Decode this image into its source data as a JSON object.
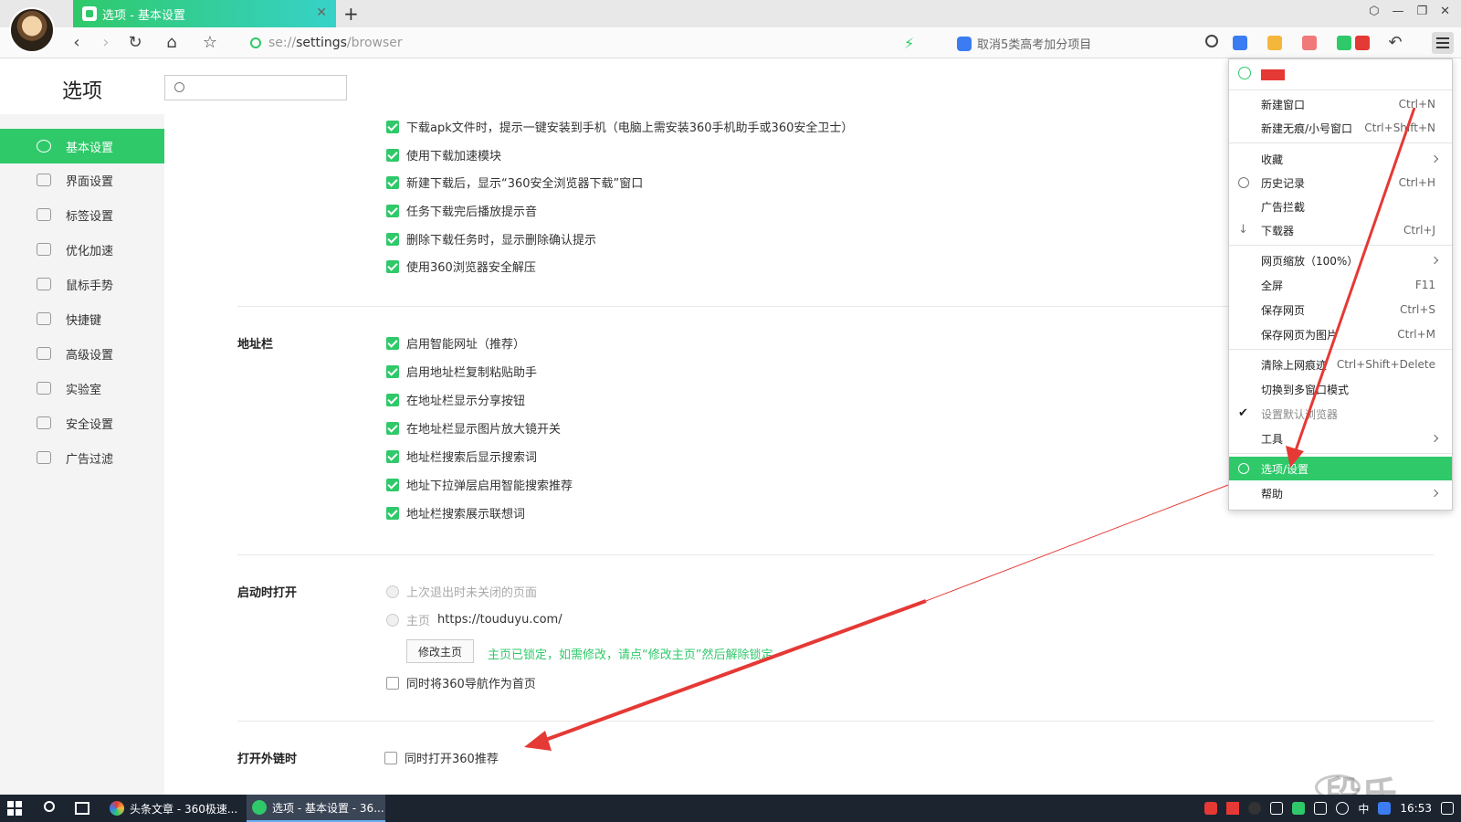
{
  "browser": {
    "active_tab_title": "选项 - 基本设置",
    "new_tab_label": "+",
    "address_scheme": "se://",
    "address_host": "settings",
    "address_path": "/browser",
    "search_hint": "取消5类高考加分项目",
    "window_controls": [
      "⬡",
      "—",
      "❐",
      "✕"
    ]
  },
  "settings": {
    "page_title": "选项",
    "search_placeholder": "",
    "sidebar": [
      {
        "label": "基本设置",
        "icon": "settings-icon",
        "active": true
      },
      {
        "label": "界面设置",
        "icon": "layout-icon",
        "active": false
      },
      {
        "label": "标签设置",
        "icon": "tab-icon",
        "active": false
      },
      {
        "label": "优化加速",
        "icon": "bolt-icon",
        "active": false
      },
      {
        "label": "鼠标手势",
        "icon": "mouse-icon",
        "active": false
      },
      {
        "label": "快捷键",
        "icon": "keyboard-icon",
        "active": false
      },
      {
        "label": "高级设置",
        "icon": "wrench-icon",
        "active": false
      },
      {
        "label": "实验室",
        "icon": "flask-icon",
        "active": false
      },
      {
        "label": "安全设置",
        "icon": "shield-icon",
        "active": false
      },
      {
        "label": "广告过滤",
        "icon": "block-icon",
        "active": false
      }
    ],
    "download_options": [
      {
        "label": "下载apk文件时，提示一键安装到手机（电脑上需安装360手机助手或360安全卫士）",
        "checked": true
      },
      {
        "label": "使用下载加速模块",
        "checked": true
      },
      {
        "label": "新建下载后，显示“360安全浏览器下载”窗口",
        "checked": true
      },
      {
        "label": "任务下载完后播放提示音",
        "checked": true
      },
      {
        "label": "删除下载任务时，显示删除确认提示",
        "checked": true
      },
      {
        "label": "使用360浏览器安全解压",
        "checked": true
      }
    ],
    "address_bar": {
      "label": "地址栏",
      "options": [
        {
          "label": "启用智能网址（推荐）",
          "checked": true
        },
        {
          "label": "启用地址栏复制粘贴助手",
          "checked": true
        },
        {
          "label": "在地址栏显示分享按钮",
          "checked": true
        },
        {
          "label": "在地址栏显示图片放大镜开关",
          "checked": true
        },
        {
          "label": "地址栏搜索后显示搜索词",
          "checked": true
        },
        {
          "label": "地址下拉弹层启用智能搜索推荐",
          "checked": true
        },
        {
          "label": "地址栏搜索展示联想词",
          "checked": true
        }
      ]
    },
    "startup": {
      "label": "启动时打开",
      "option_last_session": "上次退出时未关闭的页面",
      "option_homepage": "主页",
      "homepage_url": "https://touduyu.com/",
      "edit_home_button": "修改主页",
      "lock_note": "主页已锁定，如需修改，请点“修改主页”然后解除锁定",
      "nav_as_home": {
        "label": "同时将360导航作为首页",
        "checked": false
      }
    },
    "external_links": {
      "label": "打开外链时",
      "option": {
        "label": "同时打开360推荐",
        "checked": false
      }
    }
  },
  "menu": {
    "items": [
      {
        "label": "新建窗口",
        "shortcut": "Ctrl+N"
      },
      {
        "label": "新建无痕/小号窗口",
        "shortcut": "Ctrl+Shift+N"
      },
      {
        "label": "收藏",
        "submenu": true
      },
      {
        "label": "历史记录",
        "shortcut": "Ctrl+H",
        "icon": "clock-icon"
      },
      {
        "label": "广告拦截"
      },
      {
        "label": "下载器",
        "shortcut": "Ctrl+J",
        "icon": "download-icon"
      },
      {
        "label": "网页缩放（100%）",
        "submenu": true
      },
      {
        "label": "全屏",
        "shortcut": "F11"
      },
      {
        "label": "保存网页",
        "shortcut": "Ctrl+S"
      },
      {
        "label": "保存网页为图片",
        "shortcut": "Ctrl+M"
      },
      {
        "label": "清除上网痕迹",
        "shortcut": "Ctrl+Shift+Delete"
      },
      {
        "label": "切换到多窗口模式"
      },
      {
        "label": "设置默认浏览器",
        "checked": true
      },
      {
        "label": "工具",
        "submenu": true
      },
      {
        "label": "选项/设置",
        "highlight": true,
        "icon": "gear-icon"
      },
      {
        "label": "帮助",
        "submenu": true
      }
    ]
  },
  "taskbar": {
    "tasks": [
      {
        "label": "头条文章 - 360极速...",
        "active": false
      },
      {
        "label": "选项 - 基本设置 - 36...",
        "active": true
      }
    ],
    "ime": "中",
    "clock": "16:53"
  },
  "watermark": "段氏",
  "colors": {
    "accent": "#2fc96a",
    "arrow": "#e53935",
    "taskbar": "#1c2430"
  }
}
